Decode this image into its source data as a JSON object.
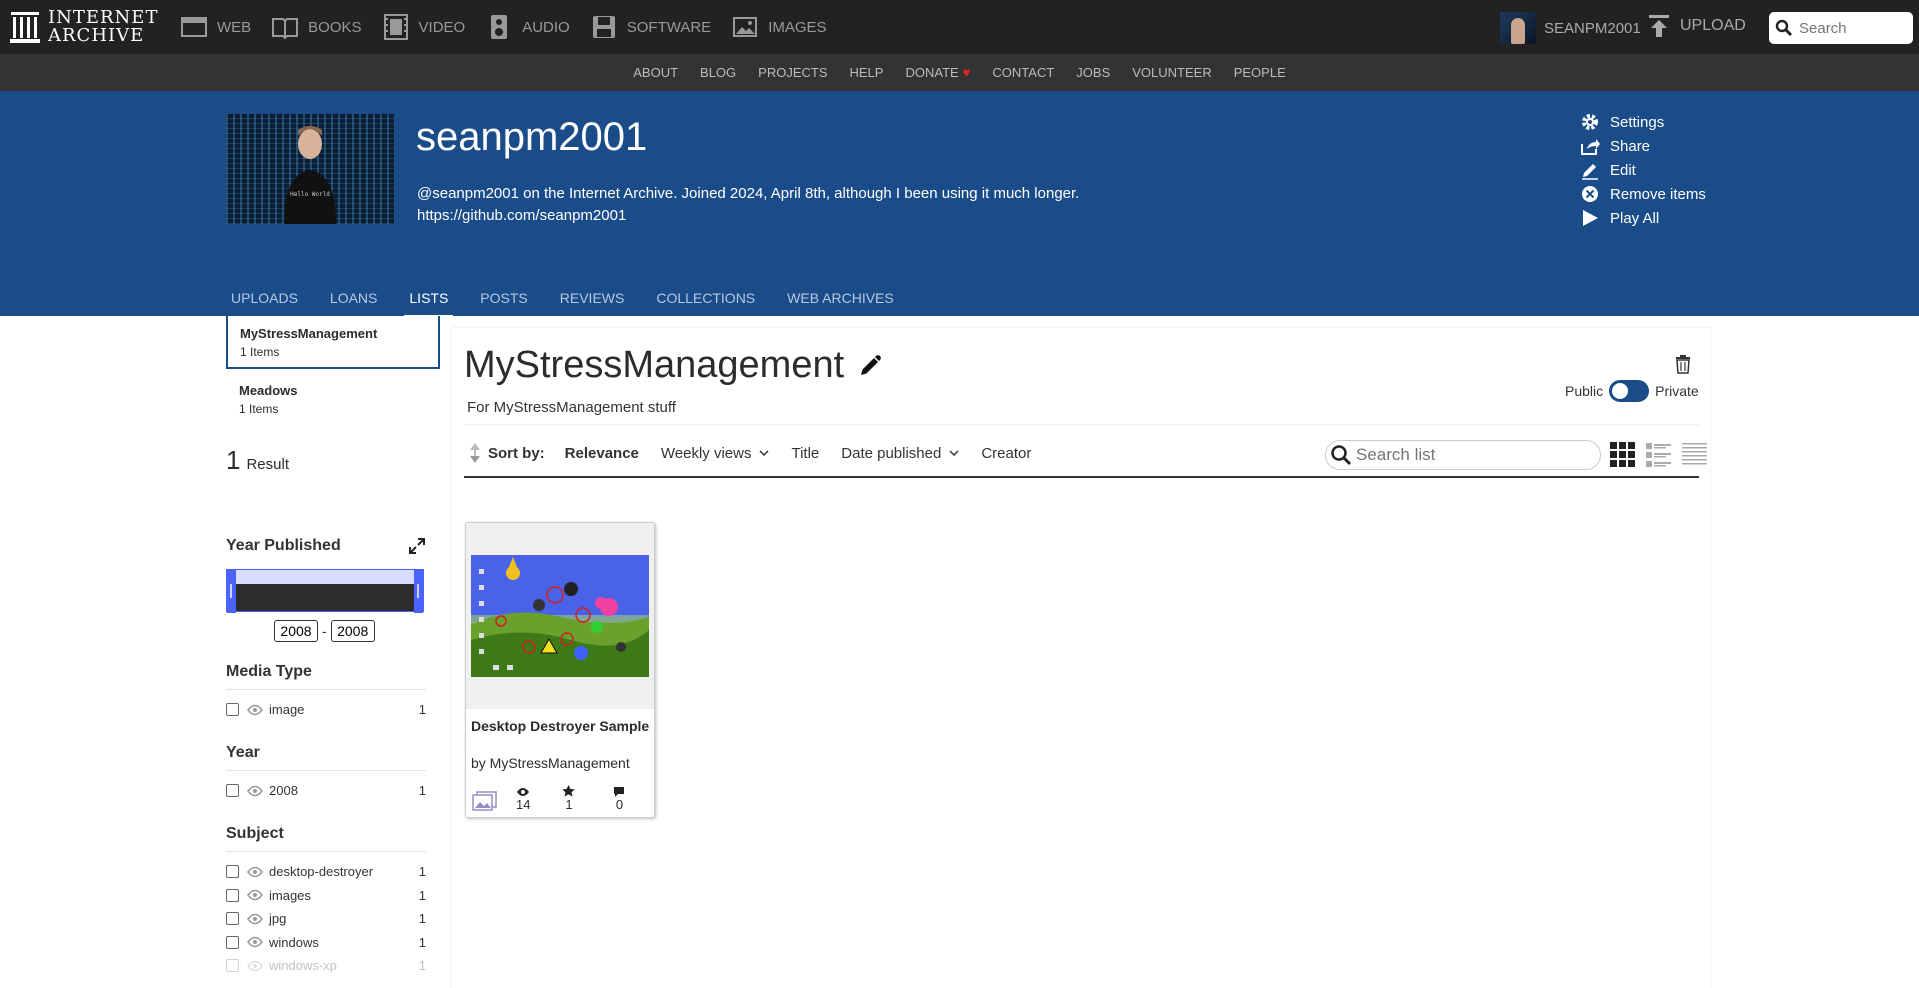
{
  "topbar": {
    "logo_line1": "INTERNET",
    "logo_line2": "ARCHIVE",
    "media": [
      {
        "label": "WEB",
        "icon": "web-icon"
      },
      {
        "label": "BOOKS",
        "icon": "books-icon"
      },
      {
        "label": "VIDEO",
        "icon": "film-icon"
      },
      {
        "label": "AUDIO",
        "icon": "speaker-icon"
      },
      {
        "label": "SOFTWARE",
        "icon": "floppy-icon"
      },
      {
        "label": "IMAGES",
        "icon": "image-icon"
      }
    ],
    "username": "SEANPM2001",
    "upload_label": "UPLOAD",
    "search_placeholder": "Search"
  },
  "subnav": [
    "ABOUT",
    "BLOG",
    "PROJECTS",
    "HELP",
    "DONATE",
    "CONTACT",
    "JOBS",
    "VOLUNTEER",
    "PEOPLE"
  ],
  "profile": {
    "name": "seanpm2001",
    "description": "@seanpm2001 on the Internet Archive. Joined 2024, April 8th, although I been using it much longer.",
    "link": "https://github.com/seanpm2001",
    "avatar_text": "Hello World"
  },
  "actions": [
    {
      "label": "Settings",
      "icon": "gear-icon"
    },
    {
      "label": "Share",
      "icon": "share-icon"
    },
    {
      "label": "Edit",
      "icon": "pencil-icon"
    },
    {
      "label": "Remove items",
      "icon": "remove-circle-icon"
    },
    {
      "label": "Play All",
      "icon": "play-icon"
    }
  ],
  "tabs": [
    "UPLOADS",
    "LOANS",
    "LISTS",
    "POSTS",
    "REVIEWS",
    "COLLECTIONS",
    "WEB ARCHIVES"
  ],
  "active_tab": "LISTS",
  "lists": [
    {
      "name": "MyStressManagement",
      "count": "1 Items",
      "active": true
    },
    {
      "name": "Meadows",
      "count": "1 Items",
      "active": false
    }
  ],
  "results": {
    "count": "1",
    "label": "Result"
  },
  "year_published": {
    "title": "Year Published",
    "from": "2008",
    "to": "2008"
  },
  "facets": {
    "media_type": {
      "title": "Media Type",
      "rows": [
        {
          "label": "image",
          "count": "1"
        }
      ]
    },
    "year": {
      "title": "Year",
      "rows": [
        {
          "label": "2008",
          "count": "1"
        }
      ]
    },
    "subject": {
      "title": "Subject",
      "rows": [
        {
          "label": "desktop-destroyer",
          "count": "1"
        },
        {
          "label": "images",
          "count": "1"
        },
        {
          "label": "jpg",
          "count": "1"
        },
        {
          "label": "windows",
          "count": "1"
        },
        {
          "label": "windows-xp",
          "count": "1"
        }
      ]
    }
  },
  "list": {
    "title": "MyStressManagement",
    "description": "For MyStressManagement stuff",
    "public_label": "Public",
    "private_label": "Private"
  },
  "sort": {
    "label": "Sort by:",
    "options": [
      {
        "label": "Relevance",
        "selected": true,
        "dropdown": false
      },
      {
        "label": "Weekly views",
        "selected": false,
        "dropdown": true
      },
      {
        "label": "Title",
        "selected": false,
        "dropdown": false
      },
      {
        "label": "Date published",
        "selected": false,
        "dropdown": true
      },
      {
        "label": "Creator",
        "selected": false,
        "dropdown": false
      }
    ],
    "search_placeholder": "Search list"
  },
  "item": {
    "title": "Desktop Destroyer Sample",
    "by": "by MyStressManagement",
    "media_icon": "image-icon",
    "views": "14",
    "favorites": "1",
    "reviews": "0"
  },
  "colors": {
    "banner": "#1b4c8a",
    "topbar": "#222222",
    "subbar": "#333333",
    "histogram_accent": "#4b64ff"
  }
}
